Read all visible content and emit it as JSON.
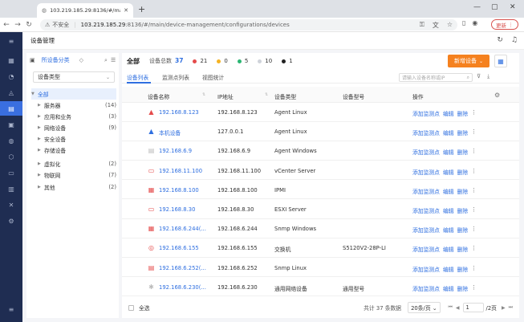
{
  "browser": {
    "tab_title": "103.219.185.29:8136/#/main/d",
    "url_host": "103.219.185.29",
    "url_rest": ":8136/#/main/device-management/configurations/devices",
    "unsafe_label": "不安全",
    "update_label": "更新"
  },
  "app": {
    "page_title": "设备管理"
  },
  "side": {
    "category_label": "所设备分类",
    "type_select": "设备类型",
    "tree": [
      {
        "label": "全部",
        "count": ""
      },
      {
        "label": "服务器",
        "count": "(14)"
      },
      {
        "label": "应用和业务",
        "count": "(3)"
      },
      {
        "label": "网络设备",
        "count": "(9)"
      },
      {
        "label": "安全设备",
        "count": ""
      },
      {
        "label": "存储设备",
        "count": ""
      },
      {
        "label": "虚拟化",
        "count": "(2)"
      },
      {
        "label": "物联网",
        "count": "(7)"
      },
      {
        "label": "其他",
        "count": "(2)"
      }
    ]
  },
  "summary": {
    "all_label": "全部",
    "total_label": "设备总数",
    "total": "37",
    "stats": [
      {
        "color": "#e54b4b",
        "value": "21"
      },
      {
        "color": "#f5b324",
        "value": "0"
      },
      {
        "color": "#2bb673",
        "value": "5"
      },
      {
        "color": "#cfd3da",
        "value": "10"
      },
      {
        "color": "#222222",
        "value": "1"
      }
    ],
    "add_button": "新增设备"
  },
  "tabs": [
    "设备列表",
    "监测点列表",
    "视图统计"
  ],
  "search_placeholder": "请输入设备名称或IP",
  "columns": [
    "设备名称",
    "IP地址",
    "设备类型",
    "设备型号",
    "操作"
  ],
  "ops": [
    "添加监测点",
    "编辑",
    "删除"
  ],
  "rows": [
    {
      "icon": "linux-icon",
      "glyph": "▲",
      "color": "#e54b4b",
      "name": "192.168.8.123",
      "ip": "192.168.8.123",
      "type": "Agent Linux",
      "model": ""
    },
    {
      "icon": "linux-icon",
      "glyph": "▲",
      "color": "#2f6fe0",
      "name": "本机设备",
      "ip": "127.0.0.1",
      "type": "Agent Linux",
      "model": ""
    },
    {
      "icon": "server-icon",
      "glyph": "▤",
      "color": "#bbbbbb",
      "name": "192.168.6.9",
      "ip": "192.168.6.9",
      "type": "Agent Windows",
      "model": ""
    },
    {
      "icon": "vcenter-icon",
      "glyph": "▭",
      "color": "#e54b4b",
      "name": "192.168.11.100",
      "ip": "192.168.11.100",
      "type": "vCenter Server",
      "model": ""
    },
    {
      "icon": "ipmi-icon",
      "glyph": "▦",
      "color": "#e54b4b",
      "name": "192.168.8.100",
      "ip": "192.168.8.100",
      "type": "IPMI",
      "model": ""
    },
    {
      "icon": "esxi-icon",
      "glyph": "▭",
      "color": "#e54b4b",
      "name": "192.168.8.30",
      "ip": "192.168.8.30",
      "type": "ESXI Server",
      "model": ""
    },
    {
      "icon": "windows-icon",
      "glyph": "▦",
      "color": "#e54b4b",
      "name": "192.168.6.244(...",
      "ip": "192.168.6.244",
      "type": "Snmp Windows",
      "model": ""
    },
    {
      "icon": "switch-icon",
      "glyph": "◎",
      "color": "#e54b4b",
      "name": "192.168.6.155",
      "ip": "192.168.6.155",
      "type": "交换机",
      "model": "S5120V2-28P-LI"
    },
    {
      "icon": "server-icon",
      "glyph": "▤",
      "color": "#e54b4b",
      "name": "192.168.6.252(...",
      "ip": "192.168.6.252",
      "type": "Snmp Linux",
      "model": ""
    },
    {
      "icon": "network-icon",
      "glyph": "✱",
      "color": "#bbbbbb",
      "name": "192.168.6.230(...",
      "ip": "192.168.6.230",
      "type": "通用网络设备",
      "model": "通用型号"
    }
  ],
  "footer": {
    "select_all": "全选",
    "total_text": "共计 37 条数据",
    "page_size": "20条/页",
    "page_current": "1",
    "page_total": "/2页"
  }
}
